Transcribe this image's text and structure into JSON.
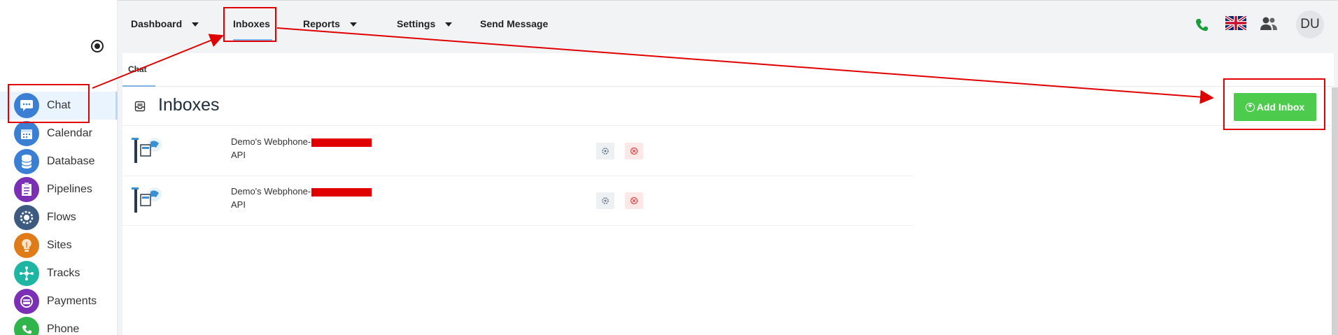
{
  "sidebar": {
    "items": [
      {
        "label": "Chat",
        "icon": "chat-icon",
        "color": "#3b7fd4"
      },
      {
        "label": "Calendar",
        "icon": "calendar-icon",
        "color": "#3b7fd4"
      },
      {
        "label": "Database",
        "icon": "database-icon",
        "color": "#3b7fd4"
      },
      {
        "label": "Pipelines",
        "icon": "pipelines-icon",
        "color": "#7a2fb5"
      },
      {
        "label": "Flows",
        "icon": "flows-icon",
        "color": "#3d5a80"
      },
      {
        "label": "Sites",
        "icon": "sites-icon",
        "color": "#e07b1a"
      },
      {
        "label": "Tracks",
        "icon": "tracks-icon",
        "color": "#1fb5a3"
      },
      {
        "label": "Payments",
        "icon": "payments-icon",
        "color": "#7a2fb5"
      },
      {
        "label": "Phone",
        "icon": "phone-icon",
        "color": "#2fb54a"
      }
    ]
  },
  "topnav": {
    "dashboard": "Dashboard",
    "inboxes": "Inboxes",
    "reports": "Reports",
    "settings": "Settings",
    "send_message": "Send Message",
    "avatar": "DU"
  },
  "tabs": {
    "chat": "Chat"
  },
  "page": {
    "title": "Inboxes",
    "add_button": "Add Inbox"
  },
  "inboxes": [
    {
      "name": "Demo's Webphone-",
      "type": "API"
    },
    {
      "name": "Demo's Webphone-",
      "type": "API"
    }
  ],
  "colors": {
    "accent_green": "#4ccb4c",
    "annotation_red": "#e00000",
    "phone_green": "#1a9e3a"
  }
}
